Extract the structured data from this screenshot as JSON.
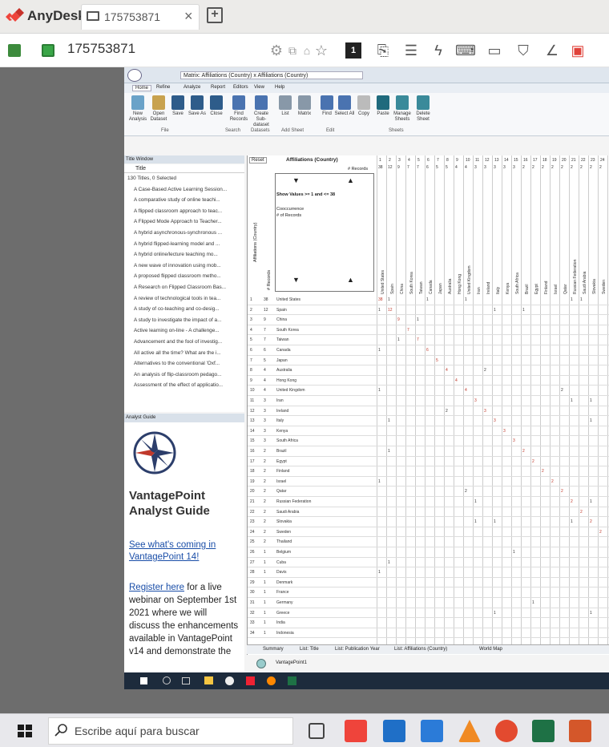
{
  "anydesk": {
    "brand": "AnyDesk",
    "tab_label": "175753871",
    "tab_close": "×",
    "session_id": "175753871"
  },
  "app": {
    "title": "Matrix: Affiliations (Country) x Affiliations (Country)",
    "ribbon_tabs": [
      "Home",
      "Refine",
      "Analyze",
      "Report",
      "Editors",
      "View",
      "Help"
    ],
    "ribbon_buttons": [
      "New Analysis",
      "Open Dataset",
      "Save",
      "Save As",
      "Close",
      "Find Records",
      "Create Sub-dataset",
      "List",
      "Matrix",
      "Find",
      "Select All",
      "Copy",
      "Paste",
      "Manage Sheets",
      "Delete Sheet"
    ],
    "ribbon_groups": [
      "File",
      "Search",
      "Datasets",
      "Add Sheet",
      "Edit",
      "Sheets"
    ]
  },
  "title_window": {
    "header": "Title Window",
    "field": "Title",
    "summary": "130 Titles, 0 Selected",
    "items": [
      "A Case-Based Active Learning Session...",
      "A comparative study of online teachi...",
      "A flipped classroom approach to teac...",
      "A Flipped Mode Approach to Teacher...",
      "A hybrid asynchronous-synchronous ...",
      "A hybrid flipped-learning model and ...",
      "A hybrid online/lecture teaching mo...",
      "A new wave of innovation using mob...",
      "A proposed flipped classroom metho...",
      "A Research on Flipped Classroom Bas...",
      "A review of technological tools in tea...",
      "A study of co-teaching and co-desig...",
      "A study to investigate the impact of a...",
      "Active learning on-line - A challenge...",
      "Advancement and the fool of investig...",
      "All active all the time? What are the i...",
      "Alternatives to the conventional 'Oxf...",
      "An analysis of flip-classroom pedago...",
      "Assessment of the effect of applicatio..."
    ]
  },
  "analyst_guide": {
    "header": "Analyst Guide",
    "title": "VantagePoint Analyst Guide",
    "link1": "See what's coming in VantagePoint 14!",
    "link2": "Register here",
    "body": "for a live webinar on September 1st 2021 where we will discuss the enhancements available in VantagePoint v14 and demonstrate the"
  },
  "matrix": {
    "reset": "Reset",
    "title": "Affiliations (Country)",
    "records_label": "# Records",
    "show_values": "Show Values >= 1 and <= 38",
    "cooccurrence": "Cooccurrence",
    "of_records": "# of Records",
    "row_axis": "Affiliations (Country)",
    "records_axis": "# Records",
    "col_headers": [
      "United States",
      "Spain",
      "China",
      "South Korea",
      "Taiwan",
      "Canada",
      "Japan",
      "Australia",
      "Hong Kong",
      "United Kingdom",
      "Iran",
      "Ireland",
      "Italy",
      "Kenya",
      "South Africa",
      "Brazil",
      "Egypt",
      "Finland",
      "Israel",
      "Qatar",
      "Russian Federation",
      "Saudi Arabia",
      "Slovakia",
      "Sweden"
    ],
    "col_nums": [
      "1",
      "2",
      "3",
      "4",
      "5",
      "6",
      "7",
      "8",
      "9",
      "10",
      "11",
      "12",
      "13",
      "14",
      "15",
      "16",
      "17",
      "18",
      "19",
      "20",
      "21",
      "22",
      "23",
      "24"
    ],
    "col_totals": [
      "38",
      "12",
      "9",
      "7",
      "7",
      "6",
      "5",
      "5",
      "4",
      "4",
      "3",
      "3",
      "3",
      "3",
      "3",
      "2",
      "2",
      "2",
      "2",
      "2",
      "2",
      "2",
      "2",
      "2"
    ],
    "rows": [
      {
        "n": "1",
        "c": "38",
        "name": "United States"
      },
      {
        "n": "2",
        "c": "12",
        "name": "Spain"
      },
      {
        "n": "3",
        "c": "9",
        "name": "China"
      },
      {
        "n": "4",
        "c": "7",
        "name": "South Korea"
      },
      {
        "n": "5",
        "c": "7",
        "name": "Taiwan"
      },
      {
        "n": "6",
        "c": "6",
        "name": "Canada"
      },
      {
        "n": "7",
        "c": "5",
        "name": "Japan"
      },
      {
        "n": "8",
        "c": "4",
        "name": "Australia"
      },
      {
        "n": "9",
        "c": "4",
        "name": "Hong Kong"
      },
      {
        "n": "10",
        "c": "4",
        "name": "United Kingdom"
      },
      {
        "n": "11",
        "c": "3",
        "name": "Iran"
      },
      {
        "n": "12",
        "c": "3",
        "name": "Ireland"
      },
      {
        "n": "13",
        "c": "3",
        "name": "Italy"
      },
      {
        "n": "14",
        "c": "3",
        "name": "Kenya"
      },
      {
        "n": "15",
        "c": "3",
        "name": "South Africa"
      },
      {
        "n": "16",
        "c": "2",
        "name": "Brazil"
      },
      {
        "n": "17",
        "c": "2",
        "name": "Egypt"
      },
      {
        "n": "18",
        "c": "2",
        "name": "Finland"
      },
      {
        "n": "19",
        "c": "2",
        "name": "Israel"
      },
      {
        "n": "20",
        "c": "2",
        "name": "Qatar"
      },
      {
        "n": "21",
        "c": "2",
        "name": "Russian Federation"
      },
      {
        "n": "22",
        "c": "2",
        "name": "Saudi Arabia"
      },
      {
        "n": "23",
        "c": "2",
        "name": "Slovakia"
      },
      {
        "n": "24",
        "c": "2",
        "name": "Sweden"
      },
      {
        "n": "25",
        "c": "2",
        "name": "Thailand"
      },
      {
        "n": "26",
        "c": "1",
        "name": "Belgium"
      },
      {
        "n": "27",
        "c": "1",
        "name": "Cuba"
      },
      {
        "n": "28",
        "c": "1",
        "name": "Davis"
      },
      {
        "n": "29",
        "c": "1",
        "name": "Denmark"
      },
      {
        "n": "30",
        "c": "1",
        "name": "France"
      },
      {
        "n": "31",
        "c": "1",
        "name": "Germany"
      },
      {
        "n": "32",
        "c": "1",
        "name": "Greece"
      },
      {
        "n": "33",
        "c": "1",
        "name": "India"
      },
      {
        "n": "34",
        "c": "1",
        "name": "Indonesia"
      }
    ],
    "cells": [
      {
        "r": 0,
        "c": 0,
        "v": "38"
      },
      {
        "r": 0,
        "c": 1,
        "v": "1"
      },
      {
        "r": 0,
        "c": 5,
        "v": "1"
      },
      {
        "r": 0,
        "c": 9,
        "v": "1"
      },
      {
        "r": 0,
        "c": 20,
        "v": "1"
      },
      {
        "r": 0,
        "c": 21,
        "v": "1"
      },
      {
        "r": 1,
        "c": 0,
        "v": "1"
      },
      {
        "r": 1,
        "c": 1,
        "v": "12"
      },
      {
        "r": 1,
        "c": 12,
        "v": "1"
      },
      {
        "r": 1,
        "c": 15,
        "v": "1"
      },
      {
        "r": 2,
        "c": 2,
        "v": "9"
      },
      {
        "r": 2,
        "c": 4,
        "v": "1"
      },
      {
        "r": 3,
        "c": 3,
        "v": "7"
      },
      {
        "r": 4,
        "c": 2,
        "v": "1"
      },
      {
        "r": 4,
        "c": 4,
        "v": "7"
      },
      {
        "r": 5,
        "c": 0,
        "v": "1"
      },
      {
        "r": 5,
        "c": 5,
        "v": "6"
      },
      {
        "r": 6,
        "c": 6,
        "v": "5"
      },
      {
        "r": 7,
        "c": 7,
        "v": "4"
      },
      {
        "r": 7,
        "c": 11,
        "v": "2"
      },
      {
        "r": 8,
        "c": 8,
        "v": "4"
      },
      {
        "r": 9,
        "c": 0,
        "v": "1"
      },
      {
        "r": 9,
        "c": 9,
        "v": "4"
      },
      {
        "r": 9,
        "c": 19,
        "v": "2"
      },
      {
        "r": 10,
        "c": 10,
        "v": "3"
      },
      {
        "r": 10,
        "c": 20,
        "v": "1"
      },
      {
        "r": 10,
        "c": 22,
        "v": "1"
      },
      {
        "r": 11,
        "c": 7,
        "v": "2"
      },
      {
        "r": 11,
        "c": 11,
        "v": "3"
      },
      {
        "r": 12,
        "c": 1,
        "v": "1"
      },
      {
        "r": 12,
        "c": 12,
        "v": "3"
      },
      {
        "r": 12,
        "c": 22,
        "v": "1"
      },
      {
        "r": 13,
        "c": 13,
        "v": "3"
      },
      {
        "r": 14,
        "c": 14,
        "v": "3"
      },
      {
        "r": 15,
        "c": 1,
        "v": "1"
      },
      {
        "r": 15,
        "c": 15,
        "v": "2"
      },
      {
        "r": 16,
        "c": 16,
        "v": "2"
      },
      {
        "r": 17,
        "c": 17,
        "v": "2"
      },
      {
        "r": 18,
        "c": 0,
        "v": "1"
      },
      {
        "r": 18,
        "c": 18,
        "v": "2"
      },
      {
        "r": 19,
        "c": 9,
        "v": "2"
      },
      {
        "r": 19,
        "c": 19,
        "v": "2"
      },
      {
        "r": 20,
        "c": 10,
        "v": "1"
      },
      {
        "r": 20,
        "c": 20,
        "v": "2"
      },
      {
        "r": 20,
        "c": 22,
        "v": "1"
      },
      {
        "r": 21,
        "c": 21,
        "v": "2"
      },
      {
        "r": 22,
        "c": 10,
        "v": "1"
      },
      {
        "r": 22,
        "c": 12,
        "v": "1"
      },
      {
        "r": 22,
        "c": 20,
        "v": "1"
      },
      {
        "r": 22,
        "c": 22,
        "v": "2"
      },
      {
        "r": 23,
        "c": 23,
        "v": "2"
      },
      {
        "r": 25,
        "c": 14,
        "v": "1"
      },
      {
        "r": 26,
        "c": 1,
        "v": "1"
      },
      {
        "r": 27,
        "c": 0,
        "v": "1"
      },
      {
        "r": 30,
        "c": 16,
        "v": "1"
      },
      {
        "r": 31,
        "c": 12,
        "v": "1"
      },
      {
        "r": 31,
        "c": 22,
        "v": "1"
      }
    ],
    "sheet_tabs": [
      "Summary",
      "List: Title",
      "List: Publication Year",
      "List: Affiliations (Country)",
      "World Map"
    ],
    "dataset": "VantagePoint1"
  },
  "taskbar": {
    "search_placeholder": "Escribe aquí para buscar"
  },
  "colors": {
    "anydesk_red": "#ef443b",
    "link_blue": "#1a4ea8",
    "taskbar_bg": "#e8e8ec"
  }
}
